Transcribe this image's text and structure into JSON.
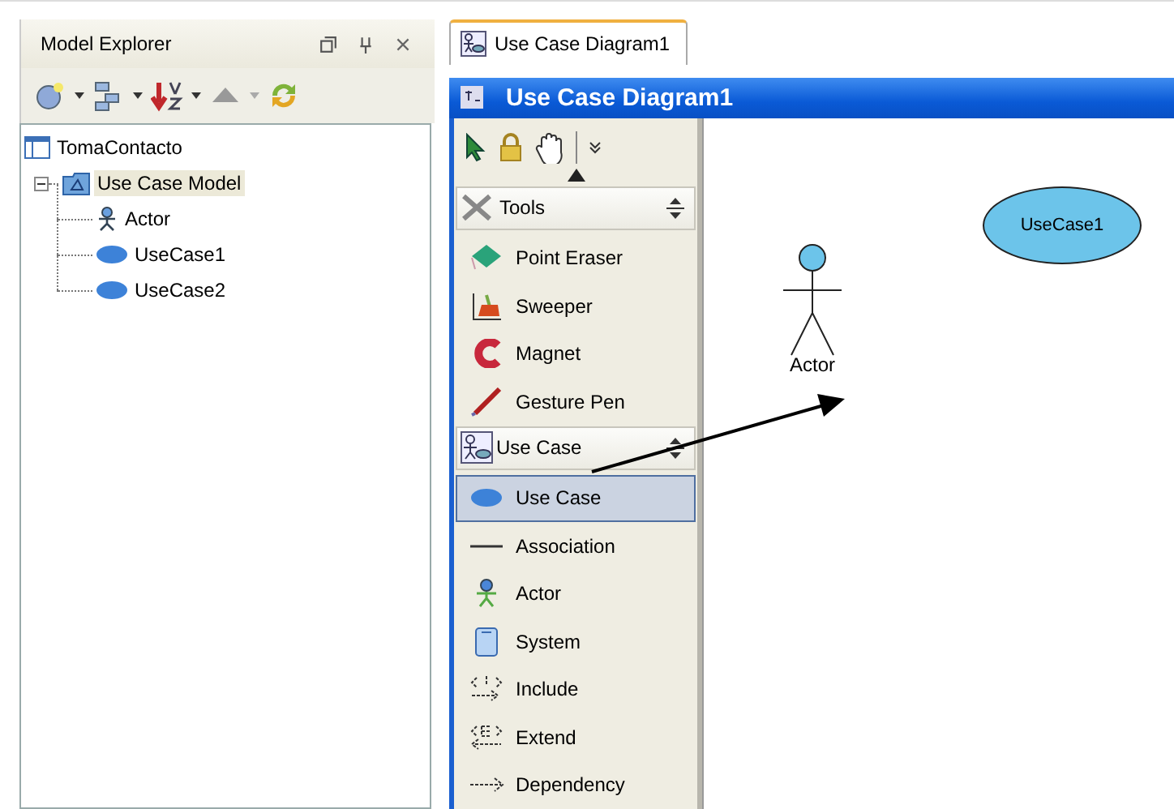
{
  "explorer": {
    "title": "Model Explorer",
    "tree": [
      {
        "label": "TomaContacto",
        "kind": "project",
        "selected": false,
        "children": [
          {
            "label": "Use Case Model",
            "kind": "model",
            "selected": true,
            "expanded": true,
            "children": [
              {
                "label": "Actor",
                "kind": "actor",
                "selected": false
              },
              {
                "label": "UseCase1",
                "kind": "usecase",
                "selected": false
              },
              {
                "label": "UseCase2",
                "kind": "usecase",
                "selected": false
              }
            ]
          }
        ]
      }
    ]
  },
  "tabs": [
    {
      "label": "Use Case Diagram1",
      "selected": true
    }
  ],
  "diagram": {
    "title": "Use Case Diagram1"
  },
  "palette": {
    "groups": [
      {
        "label": "Tools",
        "kind": "tools",
        "items": [
          {
            "label": "Point Eraser",
            "kind": "eraser",
            "selected": false
          },
          {
            "label": "Sweeper",
            "kind": "sweeper",
            "selected": false
          },
          {
            "label": "Magnet",
            "kind": "magnet",
            "selected": false
          },
          {
            "label": "Gesture Pen",
            "kind": "pen",
            "selected": false
          }
        ]
      },
      {
        "label": "Use Case",
        "kind": "usecase",
        "items": [
          {
            "label": "Use Case",
            "kind": "usecase",
            "selected": true
          },
          {
            "label": "Association",
            "kind": "association",
            "selected": false
          },
          {
            "label": "Actor",
            "kind": "actor",
            "selected": false
          },
          {
            "label": "System",
            "kind": "system",
            "selected": false
          },
          {
            "label": "Include",
            "kind": "include",
            "selected": false
          },
          {
            "label": "Extend",
            "kind": "extend",
            "selected": false
          },
          {
            "label": "Dependency",
            "kind": "dependency",
            "selected": false
          }
        ]
      }
    ]
  },
  "canvas": {
    "shapes": [
      {
        "kind": "actor",
        "label": "Actor"
      },
      {
        "kind": "usecase",
        "label": "UseCase1"
      }
    ]
  }
}
